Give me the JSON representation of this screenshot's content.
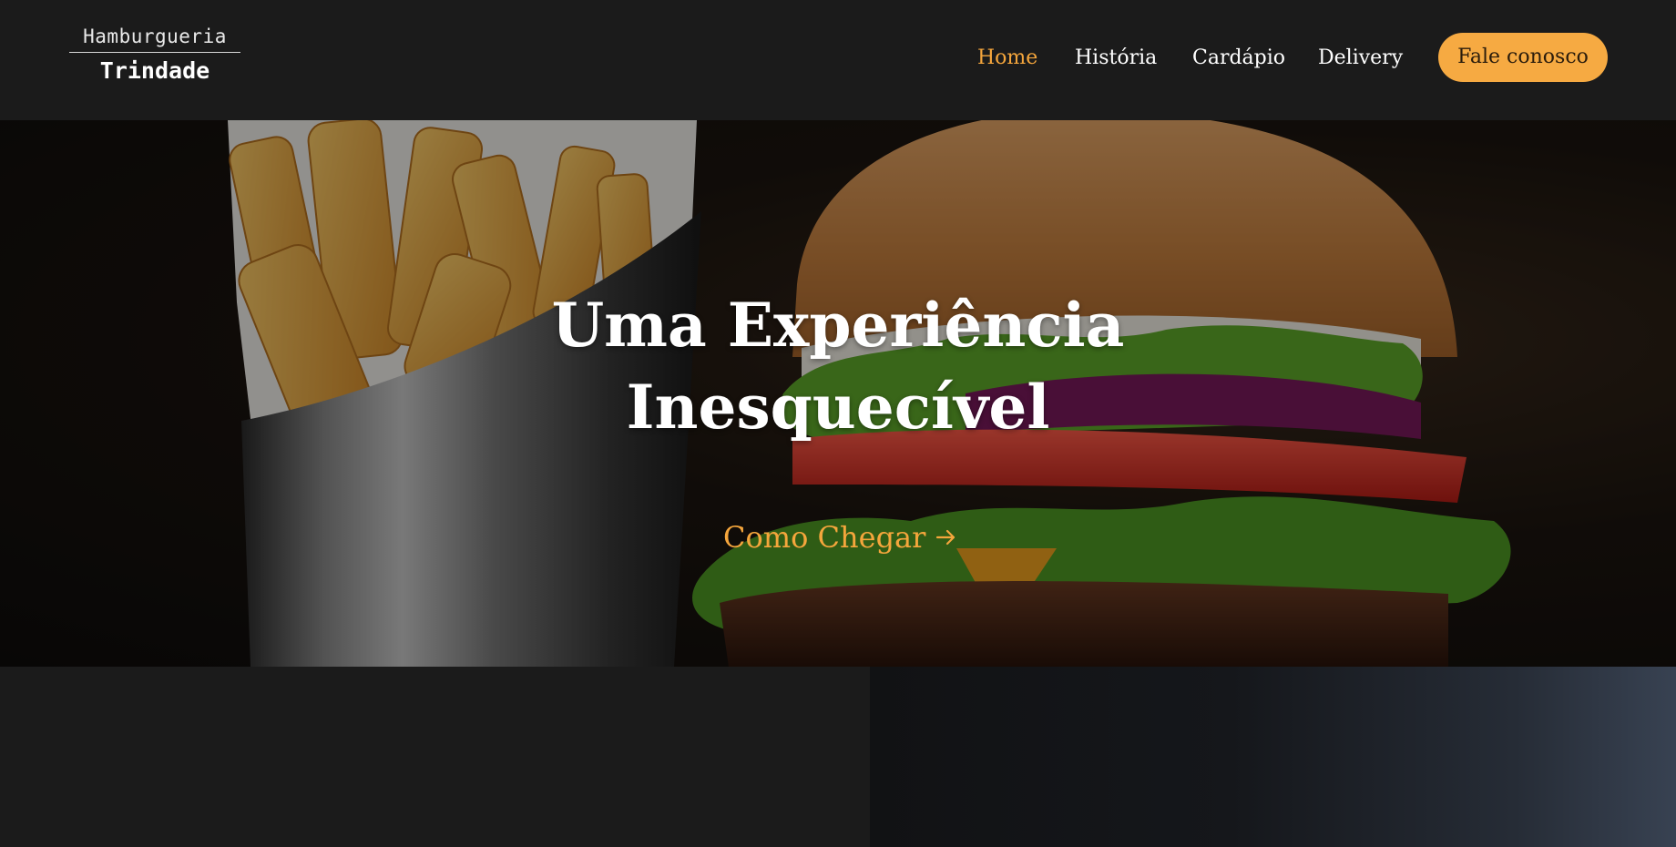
{
  "brand": {
    "line1": "Hamburgueria",
    "line2": "Trindade"
  },
  "nav": {
    "items": [
      {
        "label": "Home",
        "active": true
      },
      {
        "label": "História",
        "active": false
      },
      {
        "label": "Cardápio",
        "active": false
      },
      {
        "label": "Delivery",
        "active": false
      }
    ],
    "cta_label": "Fale conosco"
  },
  "hero": {
    "title_line1": "Uma Experiência",
    "title_line2": "Inesquecível",
    "link_label": "Como Chegar",
    "link_icon": "arrow-right-icon",
    "image_content": "fries-and-burger-photo"
  },
  "colors": {
    "accent": "#f5a63c",
    "cta_background": "#f6aa42",
    "header_background": "#1b1b1b",
    "text": "#ffffff"
  }
}
